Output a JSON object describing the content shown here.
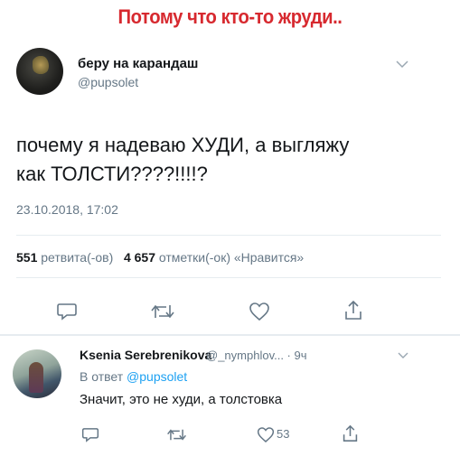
{
  "caption": "Потому что кто-то жруди..",
  "tweet": {
    "author_name": "беру на карандаш",
    "handle": "@pupsolet",
    "text_line1": "почему я надеваю ХУДИ, а выгляжу",
    "text_line2": "как ТОЛСТИ????!!!!?",
    "timestamp": "23.10.2018, 17:02",
    "retweets_count": "551",
    "retweets_label": "ретвита(-ов)",
    "likes_count": "4 657",
    "likes_label": "отметки(-ок) «Нравится»",
    "icons": [
      "reply-icon",
      "retweet-icon",
      "like-icon",
      "share-icon",
      "chevron-down-icon"
    ]
  },
  "reply": {
    "author_name": "Ksenia Serebrenikova",
    "handle_time": "@_nymphlov... · 9ч",
    "reply_to_prefix": "В ответ",
    "reply_to_handle": "@pupsolet",
    "text": "Значит, это не худи, а толстовка",
    "likes_count": "53"
  },
  "colors": {
    "caption": "#d7292f",
    "link": "#1da1f2",
    "secondary_text": "#657786",
    "divider": "#e6ecf0"
  }
}
